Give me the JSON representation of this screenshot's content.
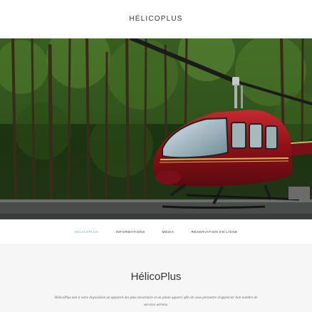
{
  "site": {
    "title": "HÉLICOPLUS"
  },
  "nav": {
    "items": [
      {
        "label": "HÉLICOPLUS",
        "active": true
      },
      {
        "label": "INFORMATIONS",
        "active": false
      },
      {
        "label": "MÉDIA",
        "active": false
      },
      {
        "label": "RÉSERVATION EN LIGNE",
        "active": false
      }
    ]
  },
  "main": {
    "heading": "HélicoPlus",
    "intro": "HélicoPlus met à votre disposition un appareil des plus sécuritaire et un pilote aguerri afin de vous permettre d'apprécier bon nombre de services aériens."
  },
  "colors": {
    "accent": "#7aa8c2",
    "text": "#333333",
    "helicopter_body": "#a0141e"
  },
  "hero": {
    "image": "red helicopter parked in front of a forest"
  }
}
